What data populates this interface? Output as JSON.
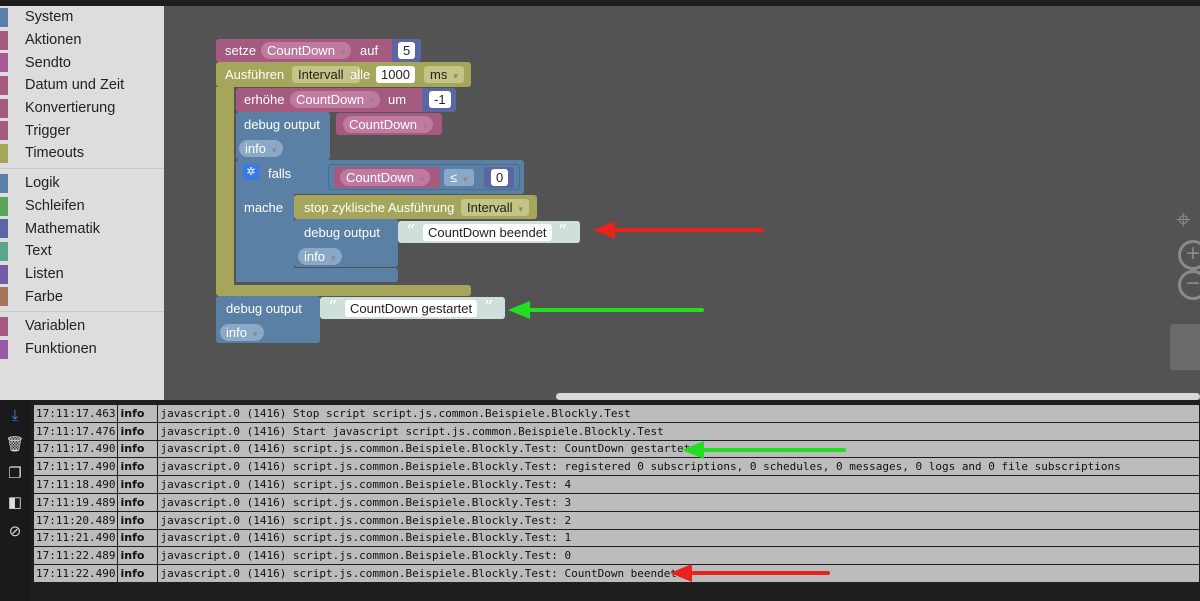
{
  "toolbox": {
    "groups": [
      [
        {
          "label": "System",
          "color": "#5b80a5"
        },
        {
          "label": "Aktionen",
          "color": "#a55b80"
        },
        {
          "label": "Sendto",
          "color": "#a55b99"
        },
        {
          "label": "Datum und Zeit",
          "color": "#a55b80"
        },
        {
          "label": "Konvertierung",
          "color": "#a55b80"
        },
        {
          "label": "Trigger",
          "color": "#a55b80"
        },
        {
          "label": "Timeouts",
          "color": "#a5a55b"
        }
      ],
      [
        {
          "label": "Logik",
          "color": "#5b80a5"
        },
        {
          "label": "Schleifen",
          "color": "#5ba55b"
        },
        {
          "label": "Mathematik",
          "color": "#5b67a5"
        },
        {
          "label": "Text",
          "color": "#5ba58c"
        },
        {
          "label": "Listen",
          "color": "#745ba5"
        },
        {
          "label": "Farbe",
          "color": "#a5745b"
        }
      ],
      [
        {
          "label": "Variablen",
          "color": "#a55b80"
        },
        {
          "label": "Funktionen",
          "color": "#995ba5"
        }
      ]
    ]
  },
  "blocks": {
    "setze": "setze",
    "var": "CountDown",
    "auf": "auf",
    "five": "5",
    "ausfuehren": "Ausführen",
    "intervall": "Intervall",
    "alle": "alle",
    "ms_value": "1000",
    "ms": "ms",
    "erhoehe": "erhöhe",
    "um": "um",
    "minus_one": "-1",
    "debug_output": "debug output",
    "info": "info",
    "falls": "falls",
    "mache": "mache",
    "le": "≤",
    "zero": "0",
    "stop": "stop zyklische Ausführung",
    "text_end": "CountDown beendet",
    "text_start": "CountDown gestartet",
    "quote_open": "“",
    "quote_close": "”"
  },
  "log": {
    "rows": [
      {
        "time": "17:11:17.463",
        "level": "info",
        "msg": "javascript.0 (1416) Stop script script.js.common.Beispiele.Blockly.Test"
      },
      {
        "time": "17:11:17.476",
        "level": "info",
        "msg": "javascript.0 (1416) Start javascript script.js.common.Beispiele.Blockly.Test"
      },
      {
        "time": "17:11:17.490",
        "level": "info",
        "msg": "javascript.0 (1416) script.js.common.Beispiele.Blockly.Test: CountDown gestartet"
      },
      {
        "time": "17:11:17.490",
        "level": "info",
        "msg": "javascript.0 (1416) script.js.common.Beispiele.Blockly.Test: registered 0 subscriptions, 0 schedules, 0 messages, 0 logs and 0 file subscriptions"
      },
      {
        "time": "17:11:18.490",
        "level": "info",
        "msg": "javascript.0 (1416) script.js.common.Beispiele.Blockly.Test: 4"
      },
      {
        "time": "17:11:19.489",
        "level": "info",
        "msg": "javascript.0 (1416) script.js.common.Beispiele.Blockly.Test: 3"
      },
      {
        "time": "17:11:20.489",
        "level": "info",
        "msg": "javascript.0 (1416) script.js.common.Beispiele.Blockly.Test: 2"
      },
      {
        "time": "17:11:21.490",
        "level": "info",
        "msg": "javascript.0 (1416) script.js.common.Beispiele.Blockly.Test: 1"
      },
      {
        "time": "17:11:22.489",
        "level": "info",
        "msg": "javascript.0 (1416) script.js.common.Beispiele.Blockly.Test: 0"
      },
      {
        "time": "17:11:22.490",
        "level": "info",
        "msg": "javascript.0 (1416) script.js.common.Beispiele.Blockly.Test: CountDown beendet"
      }
    ]
  },
  "icons": {
    "log_side": [
      "scroll-down-icon",
      "trash-icon",
      "copy-icon",
      "toggle-panel-icon",
      "hide-icon"
    ],
    "workspace": [
      "recenter-icon",
      "zoom-in-icon",
      "zoom-out-icon",
      "trash-icon"
    ]
  },
  "colors": {
    "variable": "#a55b80",
    "timeout": "#a5a55b",
    "math": "#5b80a5",
    "text": "#cfe0da",
    "arrow_red": "#e8221c",
    "arrow_green": "#22dd22"
  }
}
